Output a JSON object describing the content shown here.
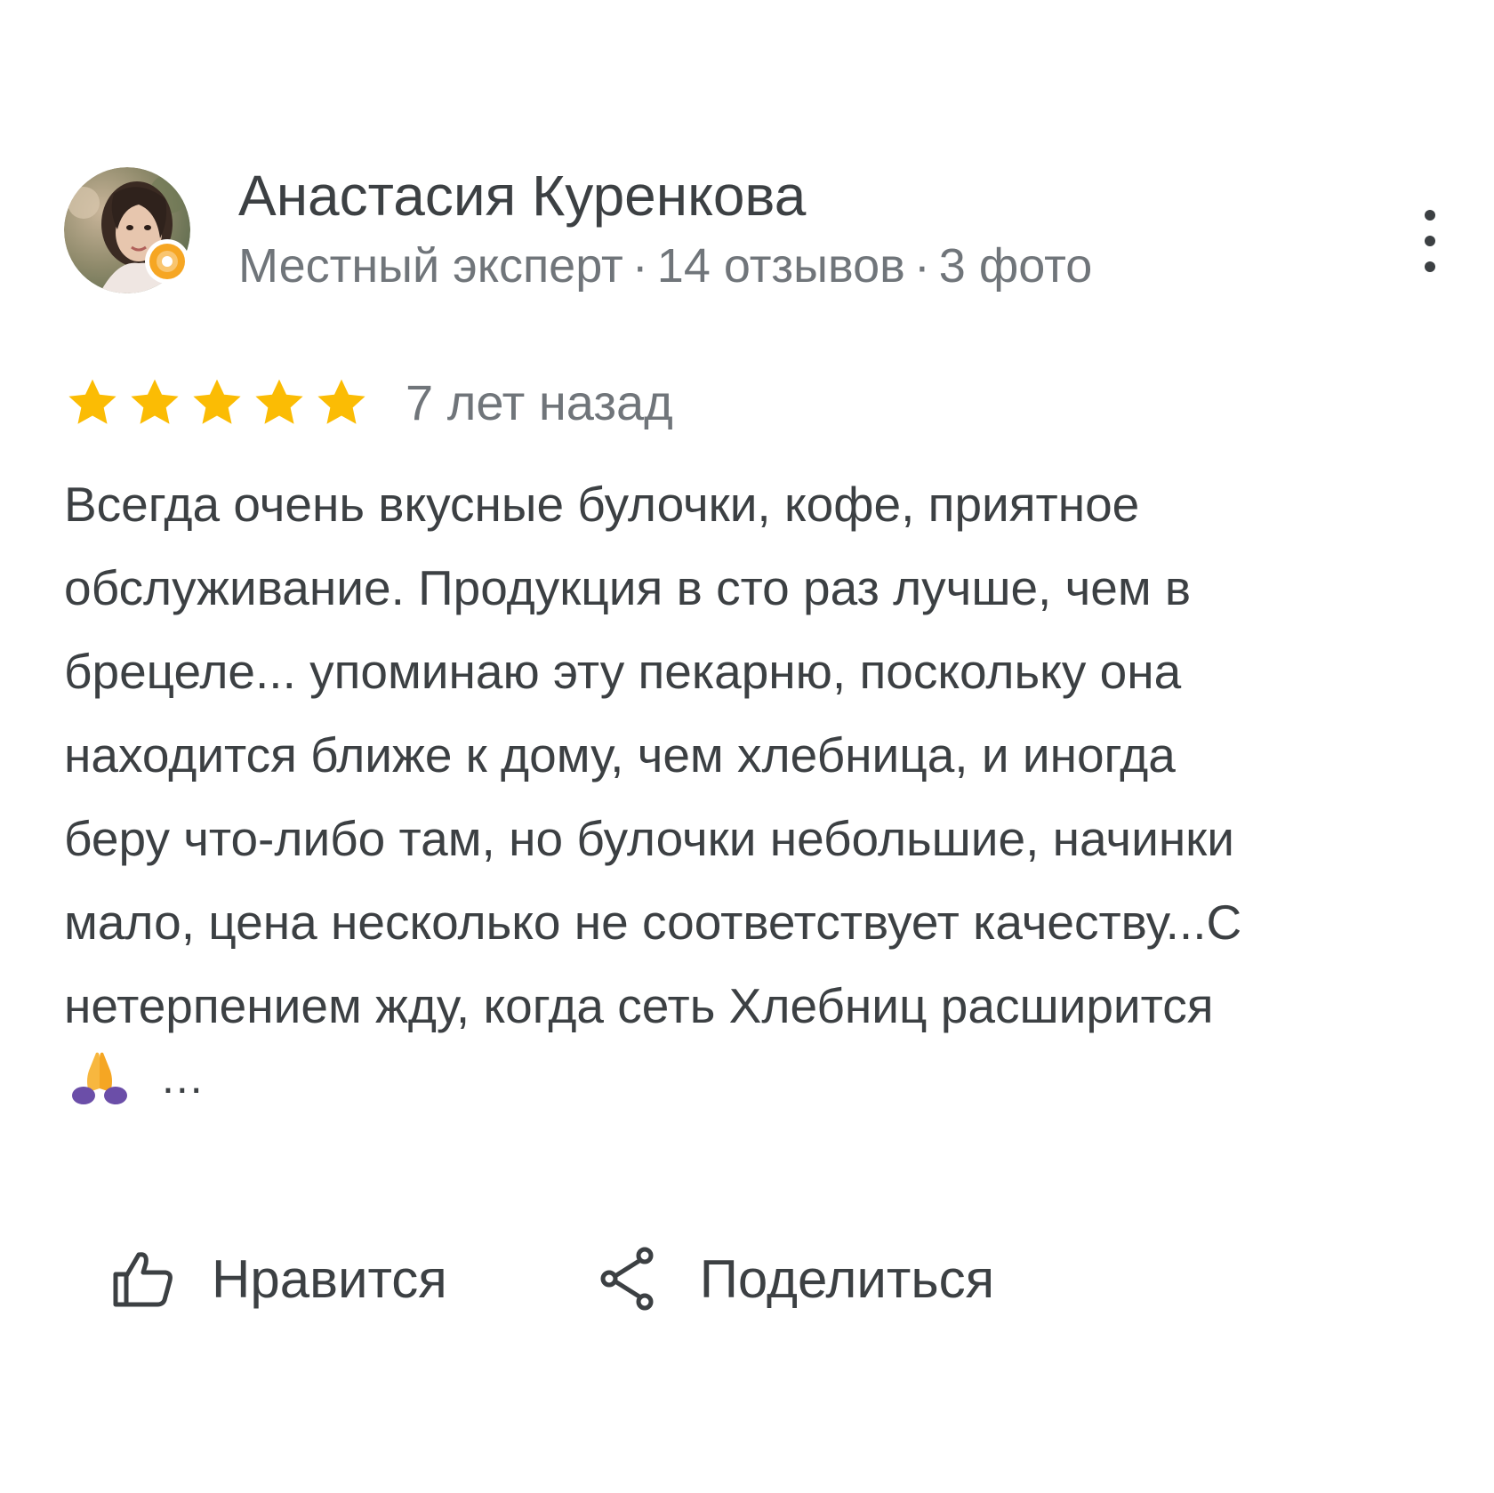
{
  "review": {
    "author": {
      "name": "Анастасия Куренкова",
      "level": "Местный эксперт",
      "reviews_count": "14 отзывов",
      "photos_count": "3 фото",
      "separator": "·"
    },
    "rating": 5,
    "rating_max": 5,
    "date": "7 лет назад",
    "text": "Всегда очень вкусные булочки, кофе, приятное\nобслуживание. Продукция в сто раз лучше, чем в\nбрецеле... упоминаю эту пекарню, поскольку она\nнаходится ближе к дому, чем хлебница, и иногда\nберу что-либо там, но булочки небольшие, начинки\nмало, цена несколько не соответствует качеству...С\nнетерпением жду, когда сеть Хлебниц расширится",
    "more_label": "...",
    "emoji": "praying-hands"
  },
  "actions": {
    "like_label": "Нравится",
    "share_label": "Поделиться"
  },
  "colors": {
    "text": "#3c4043",
    "secondary": "#70757a",
    "star": "#fbbc04",
    "badge": "#f6a623",
    "emoji": "#f7b73f"
  },
  "icons": {
    "menu": "more-vert-icon",
    "like": "thumb-up-icon",
    "share": "share-icon",
    "badge": "local-guide-badge-icon",
    "star": "star-icon"
  }
}
